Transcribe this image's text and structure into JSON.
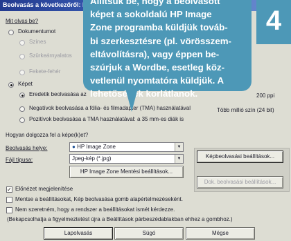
{
  "window": {
    "title": "Beolvasás a következőről: Ic"
  },
  "question_what": "Mit olvas be?",
  "doc_group": {
    "radio_document": "Dokumentumot",
    "opt_color": "Színes",
    "opt_gray": "Szürkeárnyalatos",
    "opt_bw": "Fekete-fehér"
  },
  "image_group": {
    "radio_image": "Képet",
    "opt_original": "Eredetik beolvasása az",
    "opt_negative": "Negatívok beolvasása a fólia- és filmadapter (TMA) használatával",
    "opt_positive": "Pozitívok beolvasása a TMA használatával: a 35 mm-es diák is",
    "resolution_value": "200 ppi",
    "color_depth_value": "Több millió szín (24 bit)"
  },
  "question_where": "Hogyan dolgozza fel a képe(k)et?",
  "destination": {
    "label": "Beolvasás helye:",
    "value": "HP Image Zone"
  },
  "filetype": {
    "label": "Fájl típusa:",
    "value": "Jpeg-kép (*.jpg)"
  },
  "buttons": {
    "save_settings": "HP Image Zone Mentési beállítások...",
    "image_scan_settings": "Képbeolvasási beállítások...",
    "doc_scan_settings": "Dok. beolvasási beállítások...",
    "scan": "Lapolvasás",
    "help": "Súgó",
    "cancel": "Mégse"
  },
  "options": {
    "show_preview": "Előnézet megjelenítése",
    "save_settings_check": "Mentse a beállításokat, Kép beolvasása gomb alapértelmezéseként.",
    "dont_remind": "Nem szeretném, hogy a rendszer a beállításokat ismét kérdezze.",
    "note": "(Bekapcsolhatja a figyelmeztetést újra a Beállítások párbeszédablakban ehhez a gombhoz.)"
  },
  "callout": {
    "lines": [
      "Állítsuk be, hogy a beolvasott",
      "képet a sokoldalú HP Image",
      "Zone programba küldjük továb-",
      "bi szerkesztésre (pl. vörösszem-",
      "eltávolításra), vagy éppen be-",
      "szúrjuk a Wordbe, esetleg köz-",
      "vetlenül nyomtatóra küldjük. A",
      "lehetőségek korlátlanok."
    ],
    "step_number": "4"
  },
  "colors": {
    "titlebar": "#233b8f",
    "callout": "#4d98b7",
    "dialog": "#ddddd3"
  }
}
